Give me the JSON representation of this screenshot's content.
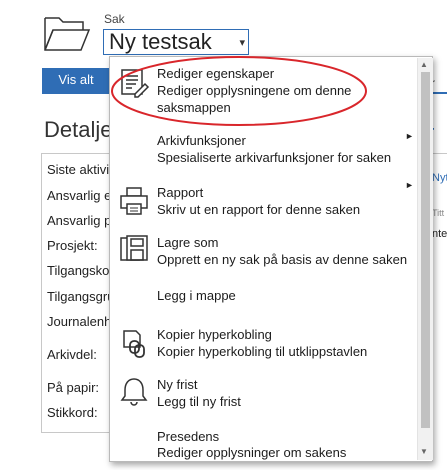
{
  "header": {
    "sak_label": "Sak",
    "case_title": "Ny testsak",
    "caret": "▾"
  },
  "tabs": {
    "vis_alt": "Vis alt"
  },
  "section": {
    "title": "Detalje",
    "right_fragment": "r",
    "right_header_fragment": "r"
  },
  "details": {
    "rows": [
      "Siste aktivit",
      "Ansvarlig e",
      "Ansvarlig p",
      "Prosjekt:",
      "Tilgangsko",
      "Tilgangsgru",
      "Journalenh",
      "Arkivdel:",
      "På papir:",
      "Stikkord:"
    ]
  },
  "right_column": {
    "link": "Nyt",
    "label": "Titt",
    "value": "nte"
  },
  "menu": {
    "items": [
      {
        "title": "Rediger egenskaper",
        "desc1": "Rediger opplysningene om denne",
        "desc2": "saksmappen",
        "icon": "edit-properties-icon"
      },
      {
        "title": "Arkivfunksjoner",
        "desc1": "Spesialiserte arkivarfunksjoner for saken",
        "submenu": true
      },
      {
        "title": "Rapport",
        "desc1": "Skriv ut en rapport for denne saken",
        "icon": "printer-icon",
        "submenu": true
      },
      {
        "title": "Lagre som",
        "desc1": "Opprett en ny sak på basis av denne saken",
        "icon": "save-as-icon"
      },
      {
        "title": "Legg i mappe"
      },
      {
        "title": "Kopier hyperkobling",
        "desc1": "Kopier hyperkobling til utklippstavlen",
        "icon": "copy-link-icon"
      },
      {
        "title": "Ny frist",
        "desc1": "Legg til ny frist",
        "icon": "bell-icon"
      },
      {
        "title": "Presedens",
        "desc1": "Rediger opplysninger om sakens"
      }
    ],
    "submenu_arrow": "►"
  },
  "colors": {
    "accent": "#2f6db5",
    "highlight": "#d9262b"
  }
}
